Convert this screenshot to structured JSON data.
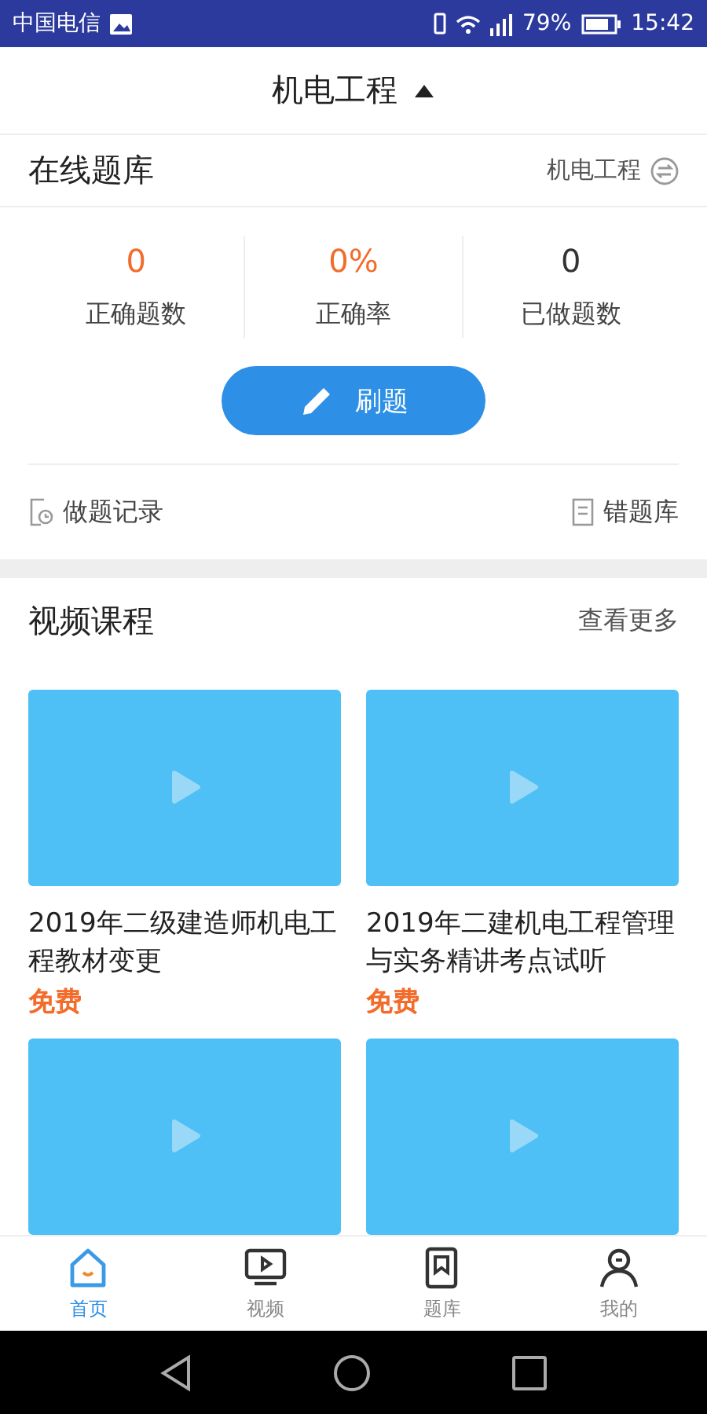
{
  "status_bar": {
    "carrier": "中国电信",
    "battery": "79%",
    "time": "15:42"
  },
  "header": {
    "title": "机电工程",
    "expanded": true
  },
  "question_bank": {
    "title": "在线题库",
    "subject": "机电工程",
    "stats": [
      {
        "value": "0",
        "label": "正确题数",
        "color": "#f26c2b"
      },
      {
        "value": "0%",
        "label": "正确率",
        "color": "#f26c2b"
      },
      {
        "value": "0",
        "label": "已做题数",
        "color": "#333333"
      }
    ],
    "practice_button": "刷题",
    "links": [
      "做题记录",
      "错题库"
    ]
  },
  "video_courses": {
    "title": "视频课程",
    "more": "查看更多",
    "courses": [
      {
        "kind": "full",
        "title": "2019年二级建造师机电工程教材变更",
        "price": "免费"
      },
      {
        "kind": "full",
        "title": "2019年二建机电工程管理与实务精讲考点试听",
        "price": "免费"
      },
      {
        "kind": "partial"
      },
      {
        "kind": "partial"
      }
    ]
  },
  "tabs": [
    {
      "label": "首页",
      "selected": true
    },
    {
      "label": "视频",
      "selected": false
    },
    {
      "label": "题库",
      "selected": false
    },
    {
      "label": "我的",
      "selected": false
    }
  ]
}
